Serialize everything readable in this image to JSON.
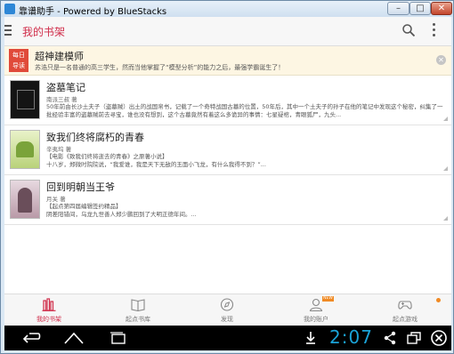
{
  "window": {
    "title": "靠谱助手  - Powered by BlueStacks",
    "min_label": "–",
    "max_label": "□",
    "close_label": "✕"
  },
  "header": {
    "title": "我的书架"
  },
  "banner": {
    "badge_line1": "每日",
    "badge_line2": "导读",
    "title": "超神建模师",
    "desc": "苏浩只是一名普通的高三学生，然而当他掌握了“模型分析”的能力之后，最强学霸诞生了！",
    "close": "✕"
  },
  "books": [
    {
      "name": "盗墓笔记",
      "author": "南派三叔 著",
      "desc": "50年前由长沙土夫子（盗墓贼）出土的战国帛书，记载了一个奇特战国古墓的位置，50年后，其中一个土夫子的孙子在他的笔记中发现这个秘密，纠集了一批经验丰富的盗墓贼前去寻宝，谁也没有想到，这个古墓竟然有着这么多诡异的事情：七星疑棺，青眼狐尸，九头..."
    },
    {
      "name": "致我们终将腐朽的青春",
      "author": "辛夷坞 著",
      "desc": "【电影《致我们终将逝去的青春》之原著小说】\n十八岁，郑微时院院说，“我爱谁，我是天下无敌的玉面小飞龙，有什么我得不到？”..."
    },
    {
      "name": "回到明朝当王爷",
      "author": "月关 著",
      "desc": "【起点第四届编辑签约精品】\n阴差阳错间，乌龙九世善人郑少鹏回到了大明正德年间。..."
    }
  ],
  "tabs": [
    {
      "label": "我的书架",
      "icon": "bookshelf-icon"
    },
    {
      "label": "起点书库",
      "icon": "book-open-icon"
    },
    {
      "label": "发现",
      "icon": "compass-icon"
    },
    {
      "label": "我的账户",
      "icon": "user-icon",
      "badge": "NEW"
    },
    {
      "label": "起点游戏",
      "icon": "gamepad-icon"
    }
  ],
  "status": {
    "clock": "2:07"
  },
  "colors": {
    "accent": "#d02d4a",
    "clock": "#1aa3d8",
    "badge": "#f08a24"
  }
}
